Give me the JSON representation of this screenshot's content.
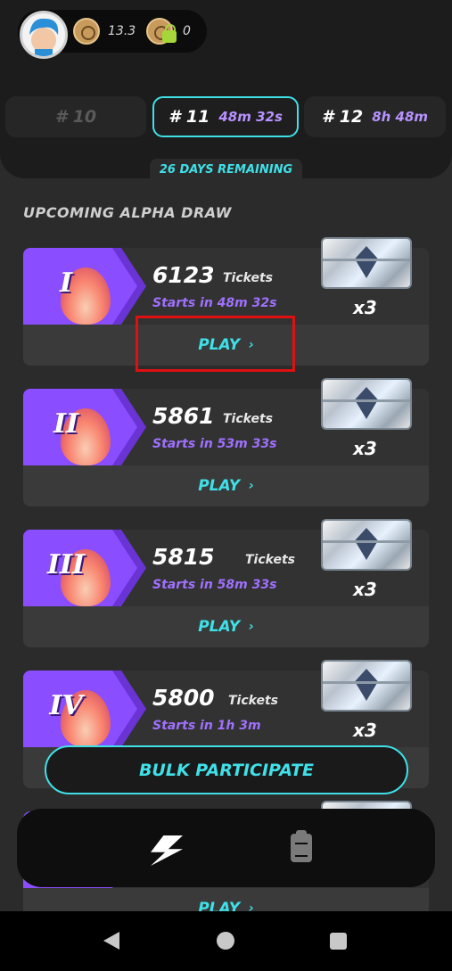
{
  "wallet": {
    "balance": "13.3",
    "locked_balance": "0"
  },
  "rounds": [
    {
      "number": "# 10",
      "time": ""
    },
    {
      "number": "# 11",
      "time": "48m 32s"
    },
    {
      "number": "# 12",
      "time": "8h 48m"
    }
  ],
  "days_remaining": "26 DAYS REMAINING",
  "section_title": "UPCOMING ALPHA DRAW",
  "draws": [
    {
      "numeral": "I",
      "tickets": "6123",
      "tickets_label": "Tickets",
      "starts": "Starts in 48m 32s",
      "multiplier": "x3",
      "play_label": "PLAY"
    },
    {
      "numeral": "II",
      "tickets": "5861",
      "tickets_label": "Tickets",
      "starts": "Starts in 53m 33s",
      "multiplier": "x3",
      "play_label": "PLAY"
    },
    {
      "numeral": "III",
      "tickets": "5815",
      "tickets_label": "Tickets",
      "starts": "Starts in 58m 33s",
      "multiplier": "x3",
      "play_label": "PLAY"
    },
    {
      "numeral": "IV",
      "tickets": "5800",
      "tickets_label": "Tickets",
      "starts": "Starts in 1h 3m",
      "multiplier": "x3",
      "play_label": ""
    },
    {
      "numeral": "",
      "tickets": "",
      "tickets_label": "",
      "starts": "",
      "multiplier": "",
      "play_label": "PLAY"
    }
  ],
  "bulk_label": "BULK PARTICIPATE",
  "chevron": "›",
  "colors": {
    "accent": "#3fe0e8",
    "purple": "#8a4dff",
    "highlight": "#e01010"
  },
  "icons": {
    "nav_left": "bolt-icon",
    "nav_right": "clipboard-icon"
  }
}
